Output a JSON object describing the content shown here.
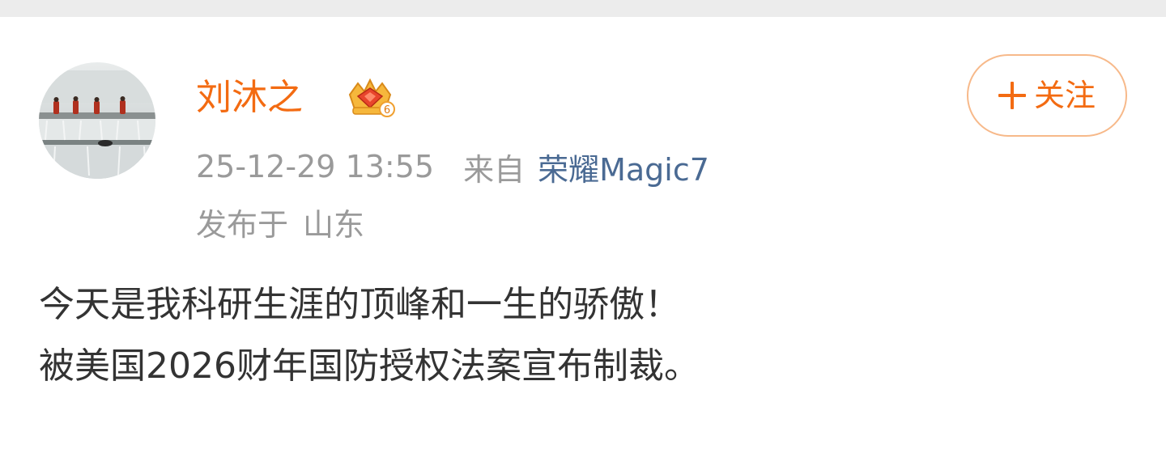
{
  "post": {
    "author": {
      "name": "刘沐之",
      "badge_icon": "vip-crown-badge-icon",
      "badge_level": "6",
      "name_color": "#f36b12"
    },
    "follow_button": {
      "icon": "plus-icon",
      "label": "关注",
      "color": "#f36b12"
    },
    "meta": {
      "timestamp": "25-12-29 13:55",
      "source_prefix": "来自",
      "device": "荣耀Magic7",
      "location_prefix": "发布于",
      "location": "山东"
    },
    "content": {
      "lines": [
        "今天是我科研生涯的顶峰和一生的骄傲！",
        "被美国2026财年国防授权法案宣布制裁。"
      ]
    }
  }
}
